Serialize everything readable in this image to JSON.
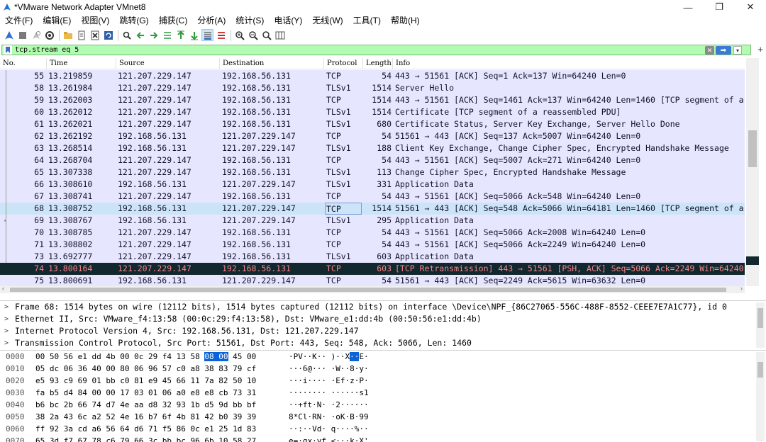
{
  "window": {
    "title": "*VMware Network Adapter VMnet8",
    "minimize": "—",
    "restore": "❐",
    "close": "✕"
  },
  "menu": [
    "文件(F)",
    "编辑(E)",
    "视图(V)",
    "跳转(G)",
    "捕获(C)",
    "分析(A)",
    "统计(S)",
    "电话(Y)",
    "无线(W)",
    "工具(T)",
    "帮助(H)"
  ],
  "toolbar_icons": [
    "shark-fin-start-icon",
    "stop-icon",
    "restart-icon",
    "options-gear-icon",
    "open-folder-icon",
    "file-icon",
    "close-file-icon",
    "reload-icon",
    "search-icon",
    "go-back-icon",
    "go-forward-icon",
    "go-to-packet-icon",
    "first-packet-icon",
    "last-packet-icon",
    "autoscroll-icon",
    "colorize-icon",
    "zoom-in-icon",
    "zoom-out-icon",
    "zoom-normal-icon",
    "resize-columns-icon"
  ],
  "filter": {
    "value": "tcp.stream eq 5",
    "apply_arrow": "➡",
    "clear": "✕",
    "dropdown": "▾",
    "add": "+"
  },
  "columns": [
    "No.",
    "Time",
    "Source",
    "Destination",
    "Protocol",
    "Length",
    "Info"
  ],
  "packets": [
    {
      "no": "55",
      "time": "13.219859",
      "src": "121.207.229.147",
      "dst": "192.168.56.131",
      "proto": "TCP",
      "len": "54",
      "info": "443 → 51561 [ACK] Seq=1 Ack=137 Win=64240 Len=0",
      "state": "normal"
    },
    {
      "no": "58",
      "time": "13.261984",
      "src": "121.207.229.147",
      "dst": "192.168.56.131",
      "proto": "TLSv1",
      "len": "1514",
      "info": "Server Hello",
      "state": "normal"
    },
    {
      "no": "59",
      "time": "13.262003",
      "src": "121.207.229.147",
      "dst": "192.168.56.131",
      "proto": "TCP",
      "len": "1514",
      "info": "443 → 51561 [ACK] Seq=1461 Ack=137 Win=64240 Len=1460 [TCP segment of a",
      "state": "normal"
    },
    {
      "no": "60",
      "time": "13.262012",
      "src": "121.207.229.147",
      "dst": "192.168.56.131",
      "proto": "TLSv1",
      "len": "1514",
      "info": "Certificate [TCP segment of a reassembled PDU]",
      "state": "normal"
    },
    {
      "no": "61",
      "time": "13.262021",
      "src": "121.207.229.147",
      "dst": "192.168.56.131",
      "proto": "TLSv1",
      "len": "680",
      "info": "Certificate Status, Server Key Exchange, Server Hello Done",
      "state": "normal"
    },
    {
      "no": "62",
      "time": "13.262192",
      "src": "192.168.56.131",
      "dst": "121.207.229.147",
      "proto": "TCP",
      "len": "54",
      "info": "51561 → 443 [ACK] Seq=137 Ack=5007 Win=64240 Len=0",
      "state": "normal"
    },
    {
      "no": "63",
      "time": "13.268514",
      "src": "192.168.56.131",
      "dst": "121.207.229.147",
      "proto": "TLSv1",
      "len": "188",
      "info": "Client Key Exchange, Change Cipher Spec, Encrypted Handshake Message",
      "state": "normal"
    },
    {
      "no": "64",
      "time": "13.268704",
      "src": "121.207.229.147",
      "dst": "192.168.56.131",
      "proto": "TCP",
      "len": "54",
      "info": "443 → 51561 [ACK] Seq=5007 Ack=271 Win=64240 Len=0",
      "state": "normal"
    },
    {
      "no": "65",
      "time": "13.307338",
      "src": "121.207.229.147",
      "dst": "192.168.56.131",
      "proto": "TLSv1",
      "len": "113",
      "info": "Change Cipher Spec, Encrypted Handshake Message",
      "state": "normal"
    },
    {
      "no": "66",
      "time": "13.308610",
      "src": "192.168.56.131",
      "dst": "121.207.229.147",
      "proto": "TLSv1",
      "len": "331",
      "info": "Application Data",
      "state": "normal"
    },
    {
      "no": "67",
      "time": "13.308741",
      "src": "121.207.229.147",
      "dst": "192.168.56.131",
      "proto": "TCP",
      "len": "54",
      "info": "443 → 51561 [ACK] Seq=5066 Ack=548 Win=64240 Len=0",
      "state": "normal"
    },
    {
      "no": "68",
      "time": "13.308752",
      "src": "192.168.56.131",
      "dst": "121.207.229.147",
      "proto": "TCP",
      "len": "1514",
      "info": "51561 → 443 [ACK] Seq=548 Ack=5066 Win=64181 Len=1460 [TCP segment of a",
      "state": "selected"
    },
    {
      "no": "69",
      "time": "13.308767",
      "src": "192.168.56.131",
      "dst": "121.207.229.147",
      "proto": "TLSv1",
      "len": "295",
      "info": "Application Data",
      "state": "normal"
    },
    {
      "no": "70",
      "time": "13.308785",
      "src": "121.207.229.147",
      "dst": "192.168.56.131",
      "proto": "TCP",
      "len": "54",
      "info": "443 → 51561 [ACK] Seq=5066 Ack=2008 Win=64240 Len=0",
      "state": "normal"
    },
    {
      "no": "71",
      "time": "13.308802",
      "src": "121.207.229.147",
      "dst": "192.168.56.131",
      "proto": "TCP",
      "len": "54",
      "info": "443 → 51561 [ACK] Seq=5066 Ack=2249 Win=64240 Len=0",
      "state": "normal"
    },
    {
      "no": "73",
      "time": "13.692777",
      "src": "121.207.229.147",
      "dst": "192.168.56.131",
      "proto": "TLSv1",
      "len": "603",
      "info": "Application Data",
      "state": "normal"
    },
    {
      "no": "74",
      "time": "13.800164",
      "src": "121.207.229.147",
      "dst": "192.168.56.131",
      "proto": "TCP",
      "len": "603",
      "info": "[TCP Retransmission] 443 → 51561 [PSH, ACK] Seq=5066 Ack=2249 Win=64240",
      "state": "bad"
    },
    {
      "no": "75",
      "time": "13.800691",
      "src": "192.168.56.131",
      "dst": "121.207.229.147",
      "proto": "TCP",
      "len": "54",
      "info": "51561 → 443 [ACK] Seq=2249 Ack=5615 Win=63632 Len=0",
      "state": "normal"
    }
  ],
  "details": [
    "Frame 68: 1514 bytes on wire (12112 bits), 1514 bytes captured (12112 bits) on interface \\Device\\NPF_{86C27065-556C-488F-8552-CEEE7E7A1C77}, id 0",
    "Ethernet II, Src: VMware_f4:13:58 (00:0c:29:f4:13:58), Dst: VMware_e1:dd:4b (00:50:56:e1:dd:4b)",
    "Internet Protocol Version 4, Src: 192.168.56.131, Dst: 121.207.229.147",
    "Transmission Control Protocol, Src Port: 51561, Dst Port: 443, Seq: 548, Ack: 5066, Len: 1460"
  ],
  "bytes": [
    {
      "off": "0000",
      "hex_a": "00 50 56 e1 dd 4b 00 0c  29 f4 13 58 ",
      "hex_hl": "08 00",
      "hex_b": " 45 00",
      "asc_a": "·PV··K·· )··X",
      "asc_hl": "··",
      "asc_b": "E·"
    },
    {
      "off": "0010",
      "hex_a": "05 dc 06 36 40 00 80 06  96 57 c0 a8 38 83 79 cf",
      "hex_hl": "",
      "hex_b": "",
      "asc_a": "···6@··· ·W··8·y·",
      "asc_hl": "",
      "asc_b": ""
    },
    {
      "off": "0020",
      "hex_a": "e5 93 c9 69 01 bb c0 81  e9 45 66 11 7a 82 50 10",
      "hex_hl": "",
      "hex_b": "",
      "asc_a": "···i···· ·Ef·z·P·",
      "asc_hl": "",
      "asc_b": ""
    },
    {
      "off": "0030",
      "hex_a": "fa b5 d4 84 00 00 17 03  01 06 a0 e8 e8 cb 73 31",
      "hex_hl": "",
      "hex_b": "",
      "asc_a": "········ ······s1",
      "asc_hl": "",
      "asc_b": ""
    },
    {
      "off": "0040",
      "hex_a": "b6 bc 2b 66 74 d7 4e aa  d8 32 93 1b d5 9d bb bf",
      "hex_hl": "",
      "hex_b": "",
      "asc_a": "··+ft·N· ·2······",
      "asc_hl": "",
      "asc_b": ""
    },
    {
      "off": "0050",
      "hex_a": "38 2a 43 6c a2 52 4e 16  b7 6f 4b 81 42 b0 39 39",
      "hex_hl": "",
      "hex_b": "",
      "asc_a": "8*Cl·RN· ·oK·B·99",
      "asc_hl": "",
      "asc_b": ""
    },
    {
      "off": "0060",
      "hex_a": "ff 92 3a cd a6 56 64 d6  71 f5 86 0c e1 25 1d 83",
      "hex_hl": "",
      "hex_b": "",
      "asc_a": "··:··Vd· q····%··",
      "asc_hl": "",
      "asc_b": ""
    },
    {
      "off": "0070",
      "hex_a": "65 3d f7 67 78 c6 79 66  3c bb bc 96 6b 10 58 27",
      "hex_hl": "",
      "hex_b": "",
      "asc_a": "e=·gx·yf <···k·X'",
      "asc_hl": "",
      "asc_b": ""
    }
  ],
  "colors": {
    "row_normal": "#e7e6ff",
    "row_selected": "#cce4f7",
    "row_bad_bg": "#12272e",
    "row_bad_fg": "#f78787",
    "filter_ok": "#b0fcb0",
    "byte_highlight": "#0a64d8"
  }
}
